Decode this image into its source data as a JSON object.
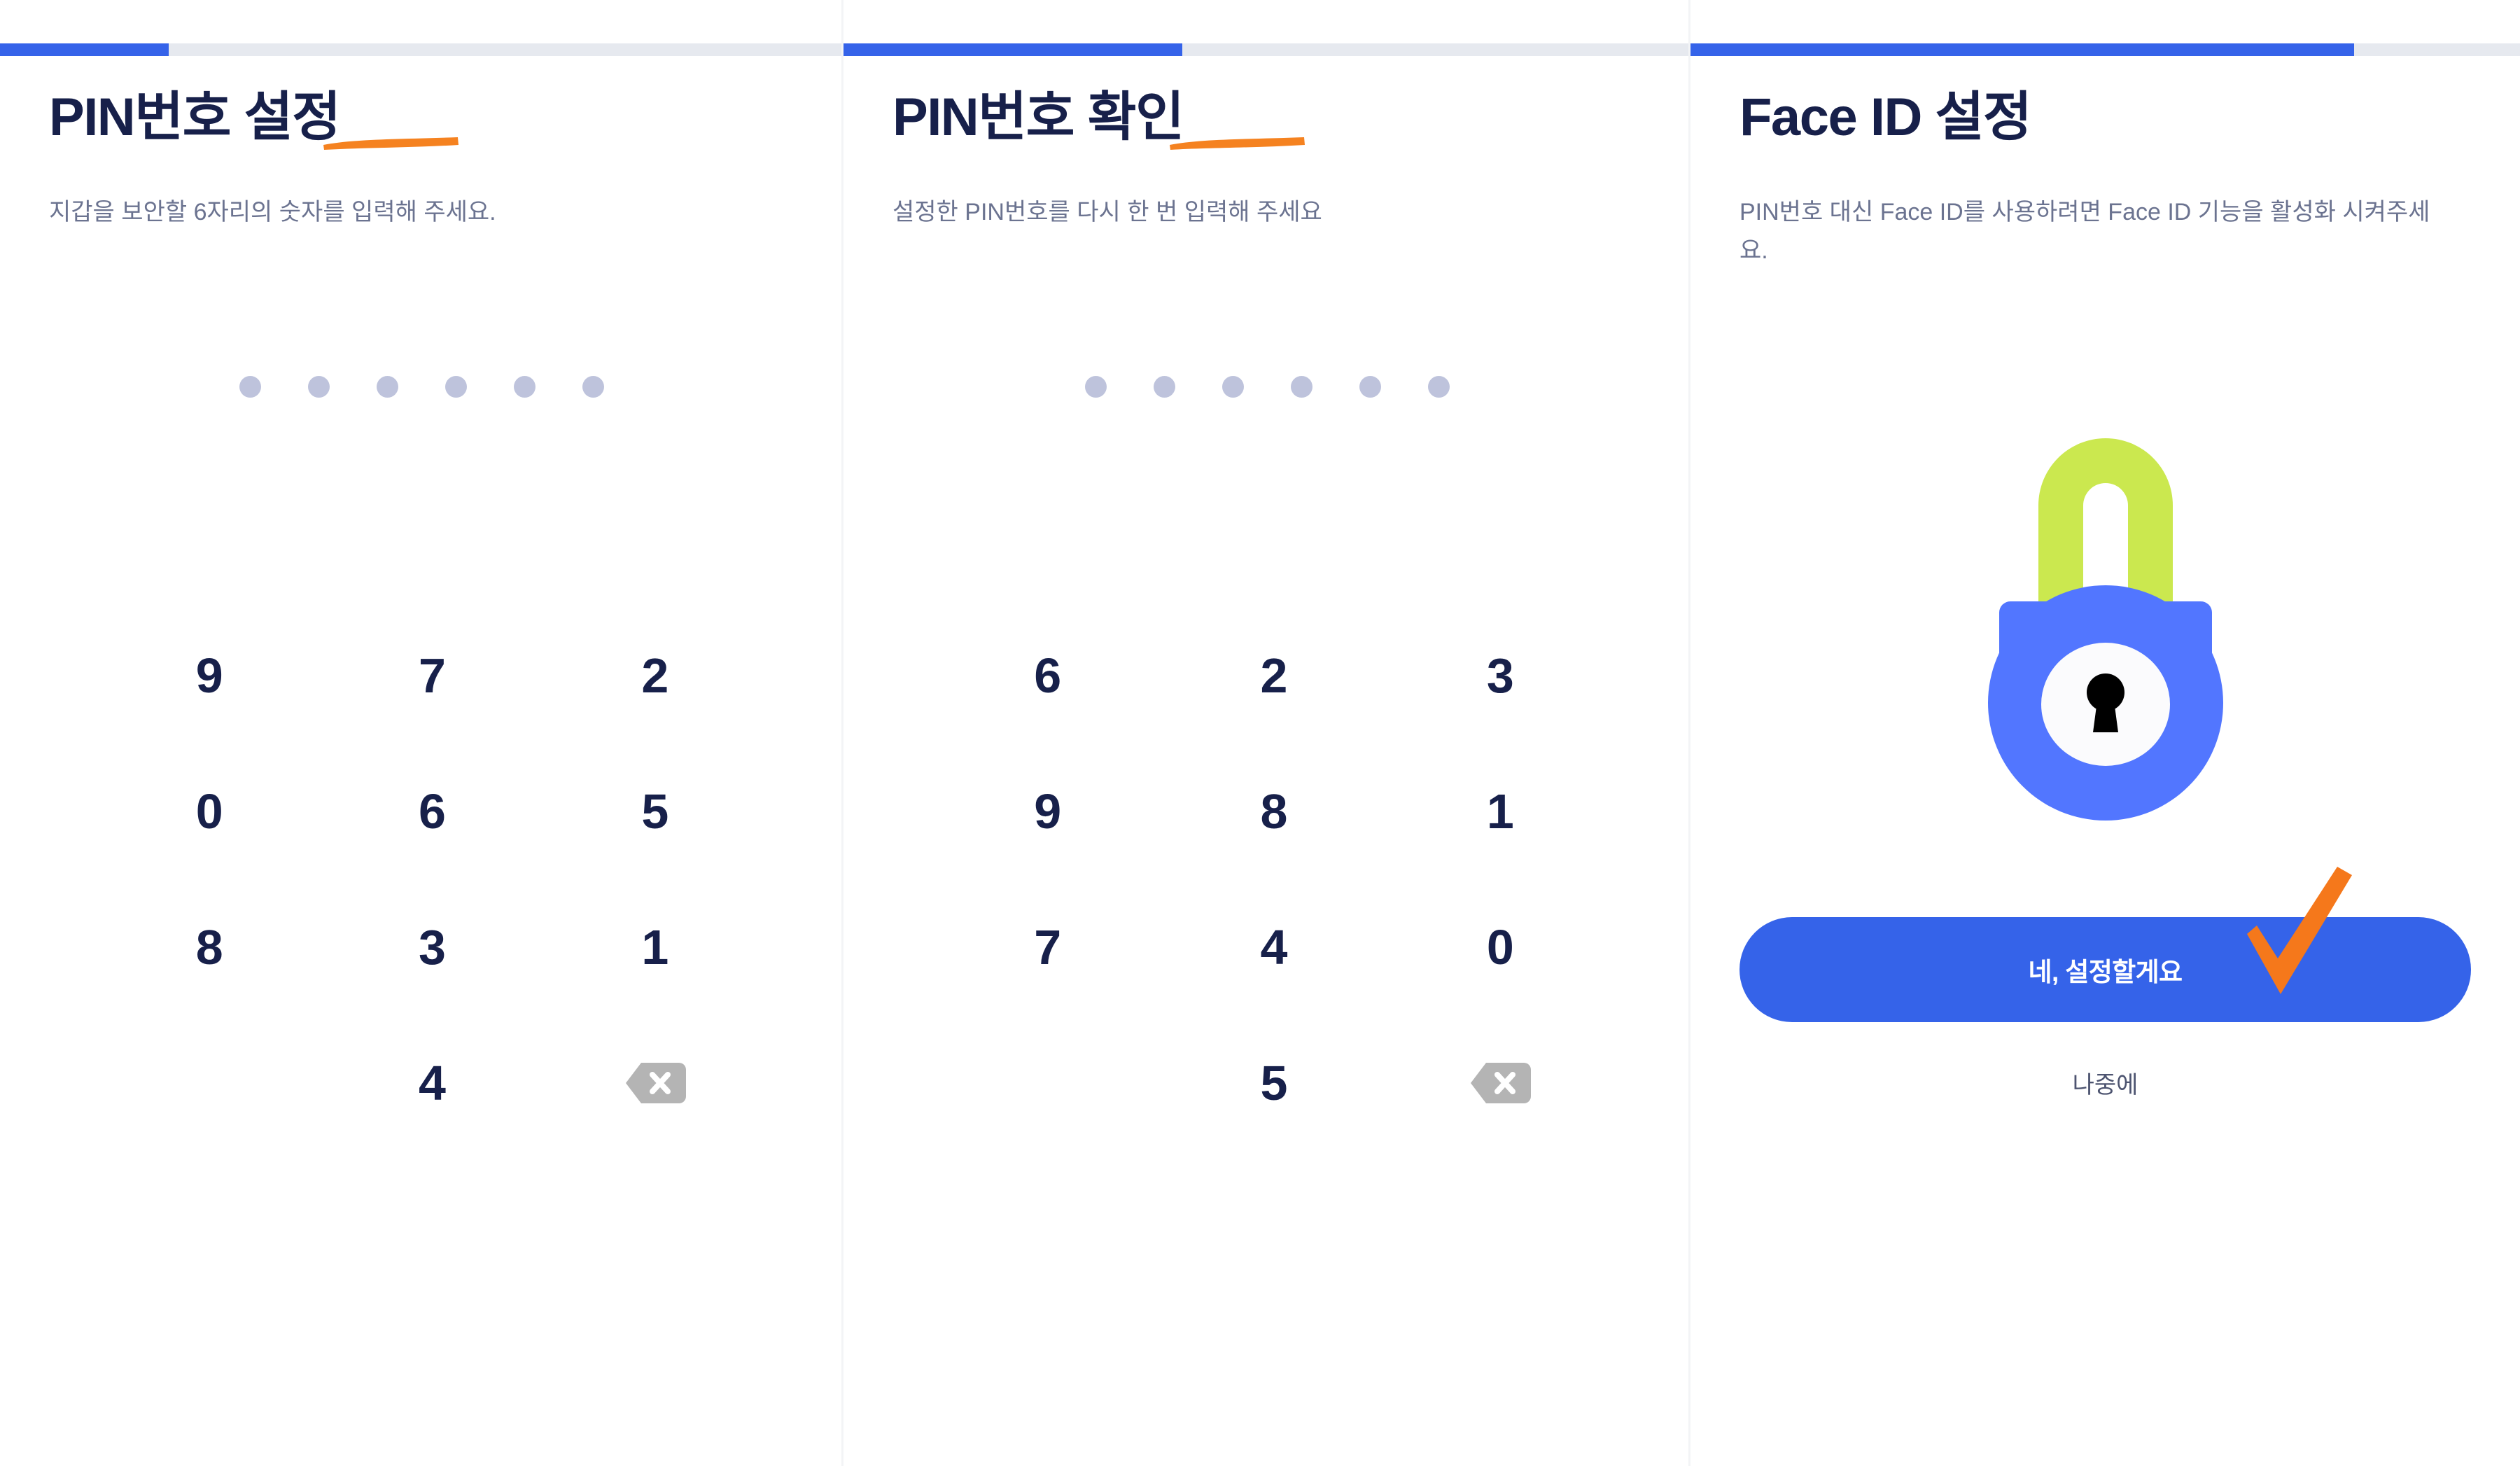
{
  "theme": {
    "accent_blue": "#3563e9",
    "track_gray": "#e6e9ef",
    "title_navy": "#17204a",
    "subtitle_gray": "#6b7390",
    "pin_dot_gray": "#bec3dc",
    "marker_orange": "#f58220",
    "lock_body_blue": "#5276ff",
    "lock_shackle_green": "#cbe84f",
    "backspace_gray": "#b4b4b4"
  },
  "screens": [
    {
      "id": "pin-setup",
      "progress_percent": 20,
      "title": "PIN번호 설정",
      "subtitle": "지갑을 보안할 6자리의 숫자를 입력해 주세요.",
      "pin_length": 6,
      "pin_filled": 0,
      "keypad": [
        "9",
        "7",
        "2",
        "0",
        "6",
        "5",
        "8",
        "3",
        "1",
        "",
        "4",
        "backspace"
      ],
      "backspace_icon": "backspace-icon"
    },
    {
      "id": "pin-confirm",
      "progress_percent": 40,
      "title": "PIN번호 확인",
      "subtitle": "설정한 PIN번호를 다시 한 번 입력해 주세요",
      "pin_length": 6,
      "pin_filled": 0,
      "keypad": [
        "6",
        "2",
        "3",
        "9",
        "8",
        "1",
        "7",
        "4",
        "0",
        "",
        "5",
        "backspace"
      ],
      "backspace_icon": "backspace-icon"
    },
    {
      "id": "faceid-setup",
      "progress_percent": 80,
      "title": "Face ID 설정",
      "subtitle": "PIN번호 대신 Face ID를 사용하려면 Face ID 기능을 활성화 시켜주세요.",
      "lock_icon": "padlock-icon",
      "primary_button": "네, 설정할게요",
      "secondary_link": "나중에",
      "annotation_icon": "orange-checkmark-icon"
    }
  ]
}
